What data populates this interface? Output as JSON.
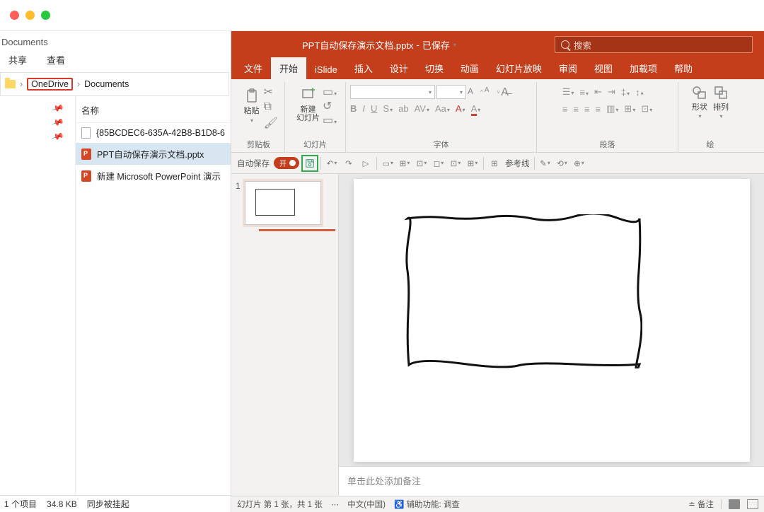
{
  "explorer": {
    "headerParent": "Documents",
    "tabs": {
      "share": "共享",
      "view": "查看"
    },
    "breadcrumb": {
      "folder": "OneDrive",
      "sub": "Documents",
      "sep": "›"
    },
    "nameHeader": "名称",
    "files": [
      {
        "name": "{85BCDEC6-635A-42B8-B1D8-6",
        "type": "file"
      },
      {
        "name": "PPT自动保存演示文档.pptx",
        "type": "ppt",
        "selected": true
      },
      {
        "name": "新建 Microsoft PowerPoint 演示",
        "type": "ppt"
      }
    ],
    "status": {
      "count": "1 个项目",
      "size": "34.8 KB",
      "sync": "同步被挂起"
    }
  },
  "ppt": {
    "title": {
      "name": "PPT自动保存演示文档.pptx",
      "state": "已保存"
    },
    "searchPlaceholder": "搜索",
    "tabs": [
      "文件",
      "开始",
      "iSlide",
      "插入",
      "设计",
      "切换",
      "动画",
      "幻灯片放映",
      "审阅",
      "视图",
      "加载项",
      "帮助"
    ],
    "activeTab": 1,
    "ribbon": {
      "clipboard": {
        "paste": "粘贴",
        "label": "剪贴板"
      },
      "slides": {
        "newSlide": "新建\n幻灯片",
        "label": "幻灯片"
      },
      "font": {
        "label": "字体"
      },
      "paragraph": {
        "label": "段落"
      },
      "shapes": {
        "shape": "形状",
        "arrange": "排列"
      },
      "drawingLabel": "绘"
    },
    "qat": {
      "autosave": "自动保存",
      "autosaveState": "开",
      "guides": "参考线"
    },
    "thumbNum": "1",
    "notesPlaceholder": "单击此处添加备注",
    "status": {
      "slideInfo": "幻灯片 第 1 张，共 1 张",
      "lang": "中文(中国)",
      "acc": "辅助功能: 调查",
      "notes": "备注"
    },
    "fontLetters": {
      "B": "B",
      "I": "I",
      "U": "U",
      "S": "S",
      "ab": "ab",
      "AV": "AV",
      "Aa": "Aa",
      "A1": "A",
      "A2": "A",
      "AB": "A",
      "AS": "A"
    }
  }
}
